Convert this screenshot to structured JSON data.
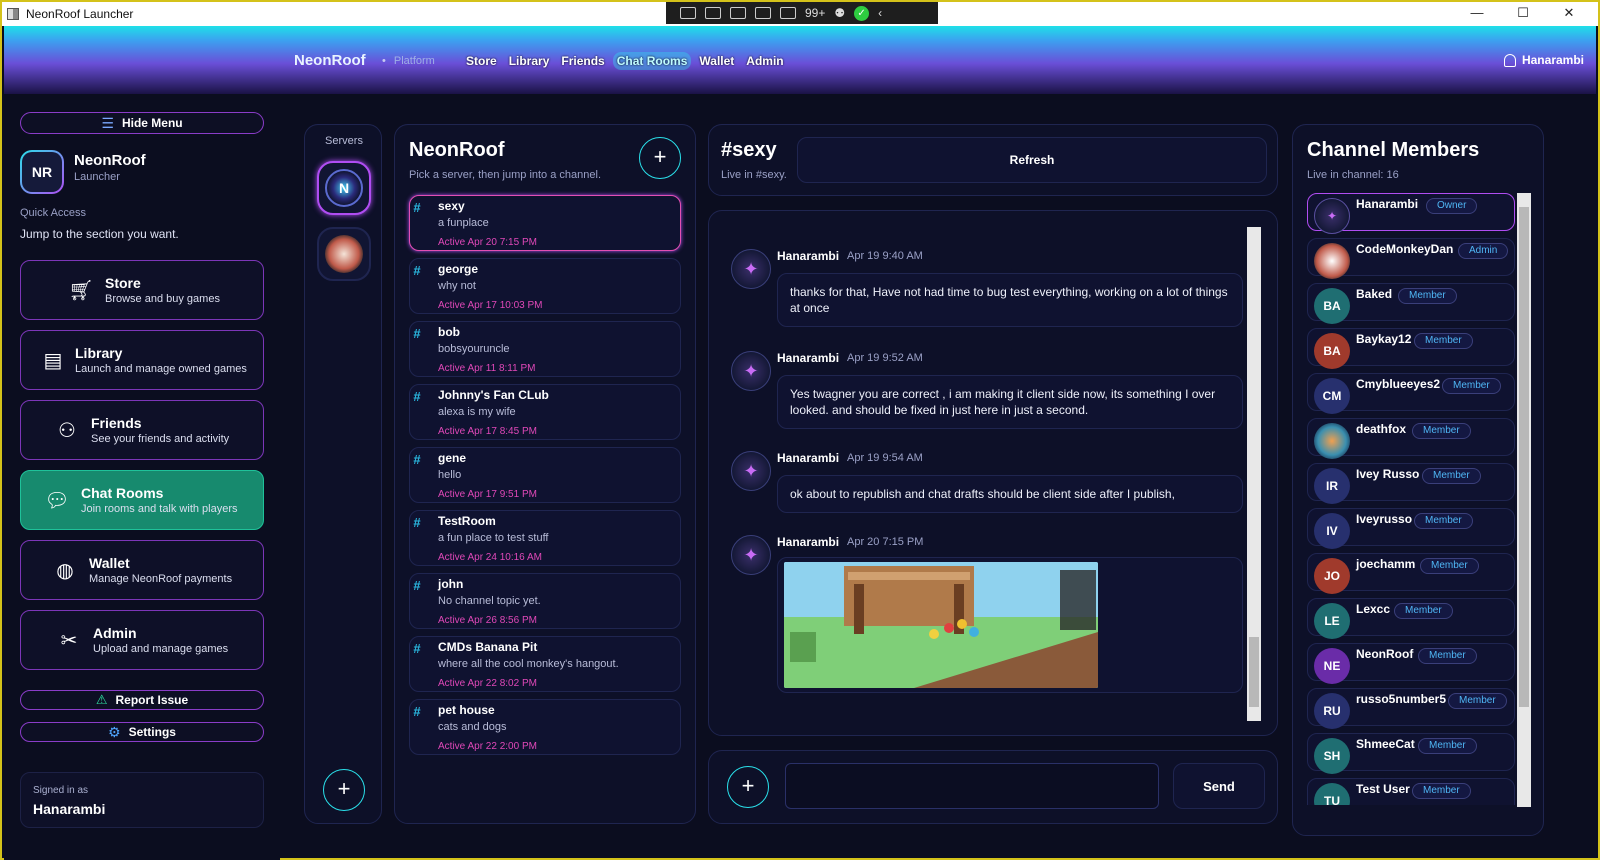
{
  "window": {
    "title": "NeonRoof Launcher",
    "controls": [
      "—",
      "☐",
      "✕"
    ],
    "tray_badge": "99+"
  },
  "header": {
    "brand": "NeonRoof",
    "platform": "Platform",
    "nav": [
      "Store",
      "Library",
      "Friends",
      "Chat Rooms",
      "Wallet",
      "Admin"
    ],
    "active_nav": "Chat Rooms",
    "user": "Hanarambi"
  },
  "sidebar": {
    "hide_menu": "Hide Menu",
    "logo_initials": "NR",
    "title": "NeonRoof",
    "subtitle": "Launcher",
    "quick_access": "Quick Access",
    "quick_access_desc": "Jump to the section you want.",
    "items": [
      {
        "title": "Store",
        "desc": "Browse and buy games",
        "icon": "cart-icon"
      },
      {
        "title": "Library",
        "desc": "Launch and manage owned games",
        "icon": "library-icon"
      },
      {
        "title": "Friends",
        "desc": "See your friends and activity",
        "icon": "friends-icon"
      },
      {
        "title": "Chat Rooms",
        "desc": "Join rooms and talk with players",
        "icon": "chat-icon"
      },
      {
        "title": "Wallet",
        "desc": "Manage NeonRoof payments",
        "icon": "wallet-icon"
      },
      {
        "title": "Admin",
        "desc": "Upload and manage games",
        "icon": "tools-icon"
      }
    ],
    "report": "Report Issue",
    "settings": "Settings",
    "signed_in_label": "Signed in as",
    "signed_in_user": "Hanarambi"
  },
  "servers": {
    "label": "Servers",
    "add": "+"
  },
  "channels": {
    "title": "NeonRoof",
    "subtitle": "Pick a server, then jump into a channel.",
    "add": "+",
    "list": [
      {
        "name": "sexy",
        "desc": "a funplace",
        "active": "Active Apr 20 7:15 PM"
      },
      {
        "name": "george",
        "desc": "why not",
        "active": "Active Apr 17 10:03 PM"
      },
      {
        "name": "bob",
        "desc": "bobsyouruncle",
        "active": "Active Apr 11 8:11 PM"
      },
      {
        "name": "Johnny's Fan CLub",
        "desc": "alexa is my wife",
        "active": "Active Apr 17 8:45 PM"
      },
      {
        "name": "gene",
        "desc": "hello",
        "active": "Active Apr 17 9:51 PM"
      },
      {
        "name": "TestRoom",
        "desc": "a fun place to test stuff",
        "active": "Active Apr 24 10:16 AM"
      },
      {
        "name": "john",
        "desc": "No channel topic yet.",
        "active": "Active Apr 26 8:56 PM"
      },
      {
        "name": "CMDs Banana Pit",
        "desc": "where all the cool monkey's hangout.",
        "active": "Active Apr 22 8:02 PM"
      },
      {
        "name": "pet house",
        "desc": "cats and dogs",
        "active": "Active Apr 22 2:00 PM"
      }
    ]
  },
  "chat": {
    "title": "#sexy",
    "subtitle": "Live in #sexy.",
    "refresh": "Refresh",
    "messages": [
      {
        "author": "Hanarambi",
        "time": "Apr 19 9:40 AM",
        "text": "thanks for that, Have not had time to bug test everything,  working on a lot of things at once"
      },
      {
        "author": "Hanarambi",
        "time": "Apr 19 9:52 AM",
        "text": "Yes twagner you are correct ,  i am making it client side now,  its something I over looked.   and should be fixed in just here in just a second."
      },
      {
        "author": "Hanarambi",
        "time": "Apr 19 9:54 AM",
        "text": "ok  about to republish and chat drafts should be client side after I publish,"
      },
      {
        "author": "Hanarambi",
        "time": "Apr 20 7:15 PM",
        "text": ""
      }
    ],
    "send": "Send",
    "add": "+"
  },
  "members": {
    "title": "Channel Members",
    "subtitle": "Live in channel: 16",
    "list": [
      {
        "name": "Hanarambi",
        "role": "Owner",
        "initials": "",
        "color": "#1a1e40"
      },
      {
        "name": "CodeMonkeyDan",
        "role": "Admin",
        "initials": "",
        "color": "#d8e8f0"
      },
      {
        "name": "Baked",
        "role": "Member",
        "initials": "BA",
        "color": "#1f6e72"
      },
      {
        "name": "Baykay12",
        "role": "Member",
        "initials": "BA",
        "color": "#a03a2c"
      },
      {
        "name": "Cmyblueeyes2",
        "role": "Member",
        "initials": "CM",
        "color": "#27306e"
      },
      {
        "name": "deathfox",
        "role": "Member",
        "initials": "",
        "color": "#3a8fb0"
      },
      {
        "name": "Ivey Russo",
        "role": "Member",
        "initials": "IR",
        "color": "#27306e"
      },
      {
        "name": "Iveyrusso",
        "role": "Member",
        "initials": "IV",
        "color": "#27306e"
      },
      {
        "name": "joechamm",
        "role": "Member",
        "initials": "JO",
        "color": "#a03a2c"
      },
      {
        "name": "Lexcc",
        "role": "Member",
        "initials": "LE",
        "color": "#1f6e72"
      },
      {
        "name": "NeonRoof",
        "role": "Member",
        "initials": "NE",
        "color": "#6a2ca8"
      },
      {
        "name": "russo5number5",
        "role": "Member",
        "initials": "RU",
        "color": "#27306e"
      },
      {
        "name": "ShmeeCat",
        "role": "Member",
        "initials": "SH",
        "color": "#1f6e72"
      },
      {
        "name": "Test User",
        "role": "Member",
        "initials": "TU",
        "color": "#1f6e72"
      }
    ]
  }
}
